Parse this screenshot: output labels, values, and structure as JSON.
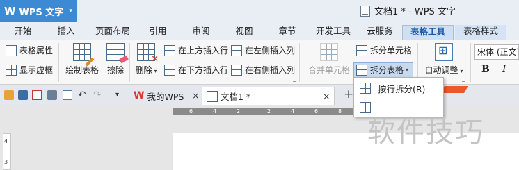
{
  "app": {
    "logo": "W",
    "name": "WPS 文字",
    "menu_caret": "▾"
  },
  "window": {
    "title": "文档1 * - WPS 文字"
  },
  "tabs": [
    {
      "label": "开始"
    },
    {
      "label": "插入"
    },
    {
      "label": "页面布局"
    },
    {
      "label": "引用"
    },
    {
      "label": "审阅"
    },
    {
      "label": "视图"
    },
    {
      "label": "章节"
    },
    {
      "label": "开发工具"
    },
    {
      "label": "云服务"
    },
    {
      "label": "表格工具"
    },
    {
      "label": "表格样式"
    }
  ],
  "ribbon": {
    "table_props": "表格属性",
    "show_gridlines": "显示虚框",
    "draw_table": "绘制表格",
    "erase": "擦除",
    "delete": "删除",
    "insert_above": "在上方插入行",
    "insert_below": "在下方插入行",
    "insert_left": "在左侧插入列",
    "insert_right": "在右侧插入列",
    "merge_cells": "合并单元格",
    "split_cells": "拆分单元格",
    "split_table": "拆分表格",
    "auto_fit": "自动调整",
    "font_name": "宋体 (正文)",
    "bold": "B",
    "italic": "I"
  },
  "doc_tabs": [
    {
      "label": "我的WPS",
      "close": "×"
    },
    {
      "label": "文档1 *",
      "close": "×"
    }
  ],
  "new_tab": "+",
  "ruler": {
    "marks": [
      "6",
      "4",
      "2",
      "2",
      "4",
      "6",
      "8",
      "10"
    ]
  },
  "vruler": {
    "marks": [
      "4",
      "3"
    ]
  },
  "dropdown": {
    "items": [
      {
        "label": "按行拆分(R)"
      },
      {
        "label": ""
      }
    ]
  },
  "watermark": "软件技巧"
}
